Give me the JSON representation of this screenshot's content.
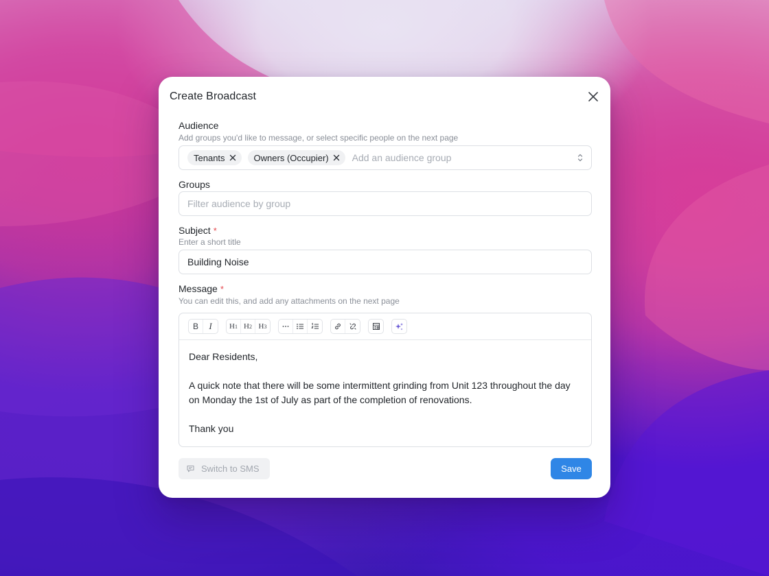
{
  "modal": {
    "title": "Create Broadcast"
  },
  "audience": {
    "label": "Audience",
    "help": "Add groups you'd like to message, or select specific people on the next page",
    "chips": [
      "Tenants",
      "Owners (Occupier)"
    ],
    "placeholder": "Add an audience group"
  },
  "groups": {
    "label": "Groups",
    "placeholder": "Filter audience by group"
  },
  "subject": {
    "label": "Subject",
    "required_mark": "*",
    "help": "Enter a short title",
    "value": "Building Noise"
  },
  "message": {
    "label": "Message",
    "required_mark": "*",
    "help": "You can edit this, and add any attachments on the next page",
    "toolbar": {
      "bold": "B",
      "italic": "I",
      "h1": "H",
      "h1_sub": "1",
      "h2": "H",
      "h2_sub": "2",
      "h3": "H",
      "h3_sub": "3"
    },
    "paragraphs": [
      "Dear Residents,",
      "A quick note that there will be some intermittent grinding from Unit 123 throughout the day on Monday the 1st of July as part of the completion of renovations.",
      "Thank you"
    ]
  },
  "footer": {
    "sms_label": "Switch to SMS",
    "save_label": "Save"
  },
  "colors": {
    "accent": "#2f86e6",
    "required": "#e5484d",
    "ai_icon": "#6b5bd6"
  }
}
